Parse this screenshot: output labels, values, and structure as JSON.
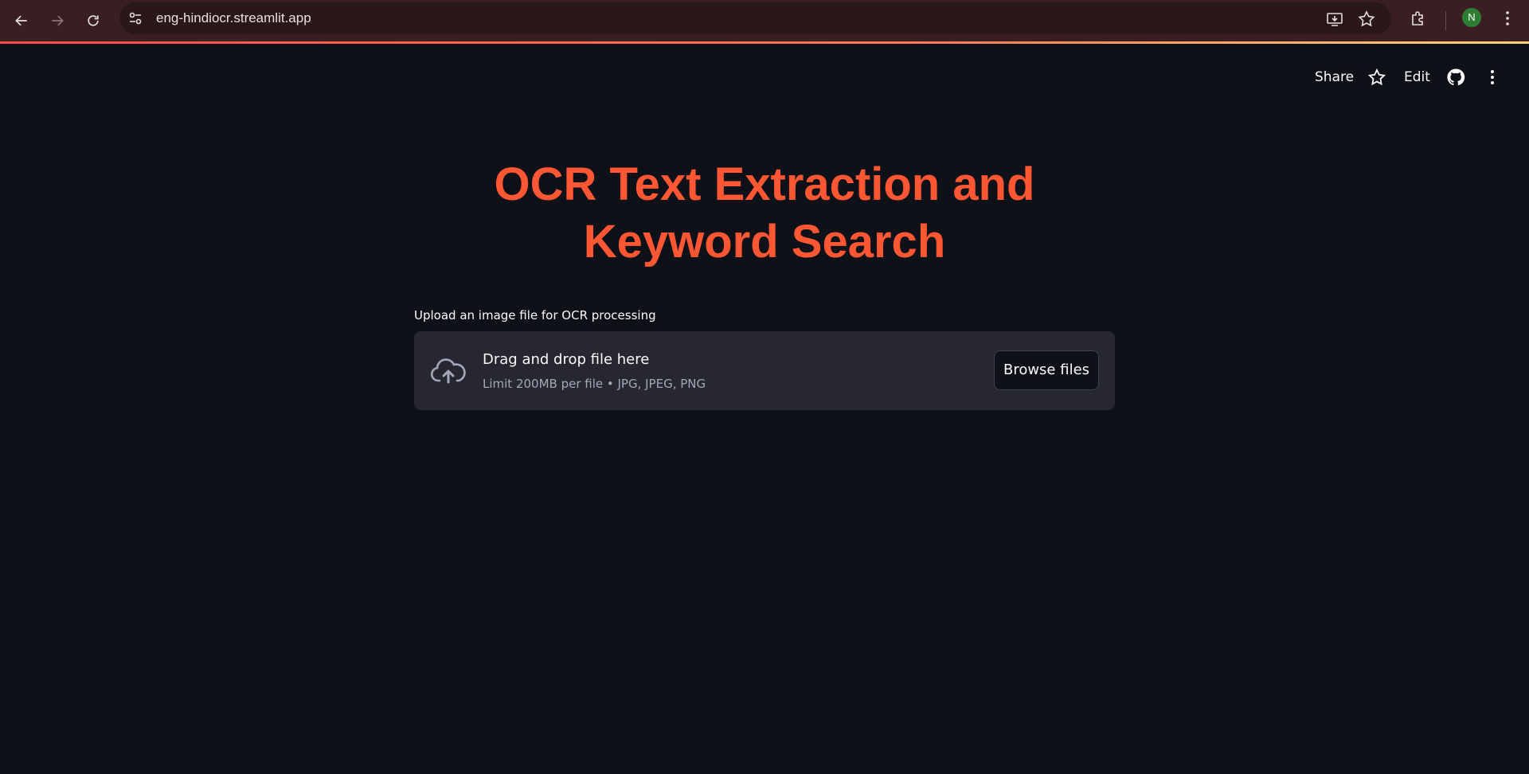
{
  "browser": {
    "url": "eng-hindiocr.streamlit.app",
    "profile_initial": "N"
  },
  "toolbar": {
    "share_label": "Share",
    "edit_label": "Edit"
  },
  "main": {
    "title_line1": "OCR Text Extraction and",
    "title_line2": "Keyword Search",
    "upload_label": "Upload an image file for OCR processing",
    "dropzone_title": "Drag and drop file here",
    "dropzone_subtitle": "Limit 200MB per file • JPG, JPEG, PNG",
    "browse_label": "Browse files"
  },
  "colors": {
    "title": "#ff5733",
    "background": "#0e1117",
    "dropzone": "#262730",
    "chrome": "#3a1f22"
  }
}
